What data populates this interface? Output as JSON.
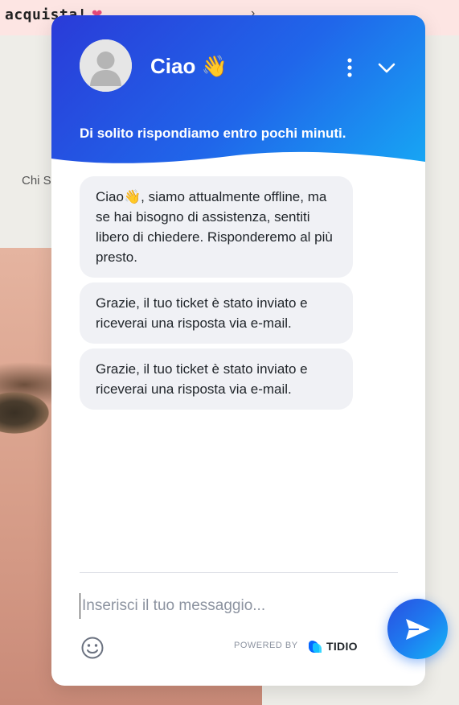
{
  "background": {
    "site_title": "acquista!",
    "nav_text": "Chi S"
  },
  "chat": {
    "title": "Ciao",
    "title_emoji": "👋",
    "subtitle": "Di solito rispondiamo entro pochi minuti.",
    "messages": [
      "Ciao👋, siamo attualmente offline, ma se hai bisogno di assistenza, sentiti libero di chiedere. Risponderemo al più presto.",
      "Grazie, il tuo ticket è stato inviato e riceverai una risposta via e-mail.",
      "Grazie, il tuo ticket è stato inviato e riceverai una risposta via e-mail."
    ],
    "input_placeholder": "Inserisci il tuo messaggio...",
    "powered_by": "POWERED BY",
    "brand": "TIDIO"
  },
  "colors": {
    "header_start": "#2a3bd8",
    "header_end": "#17a6f4",
    "bubble_bg": "#f0f1f5",
    "site_topbar": "#fde5e3"
  }
}
